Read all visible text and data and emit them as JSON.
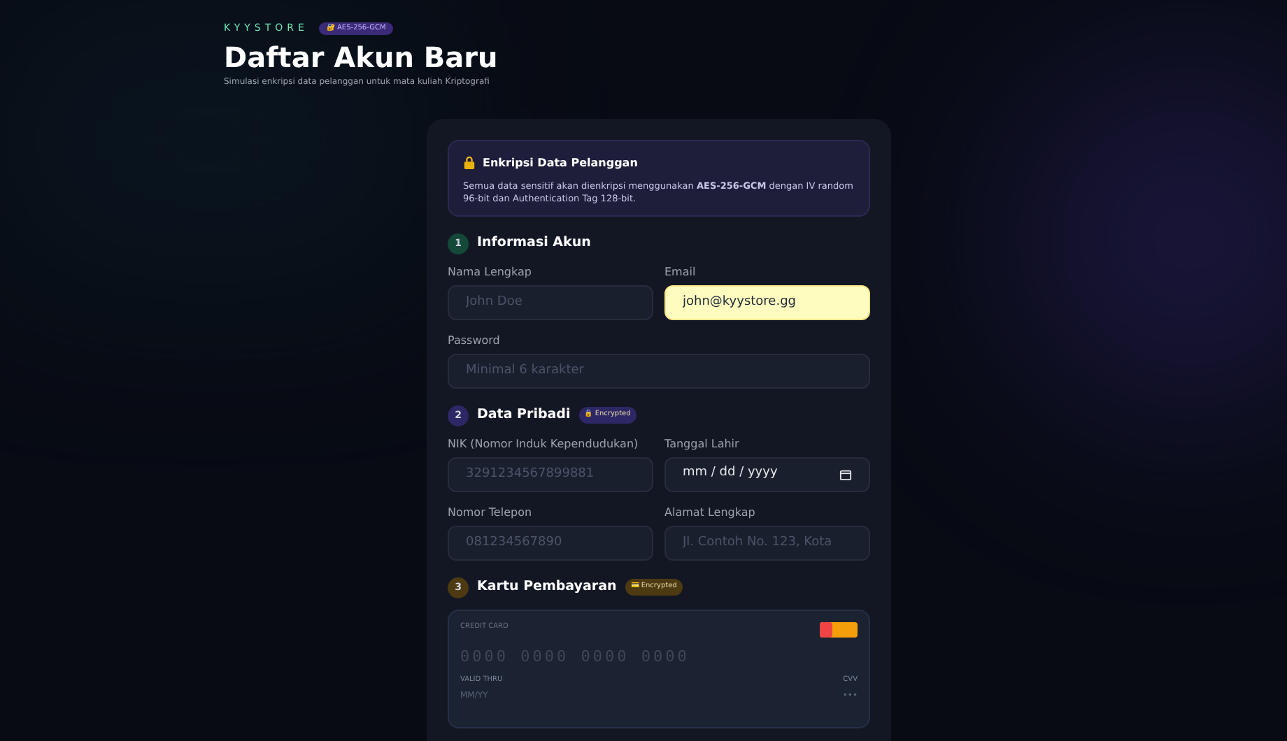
{
  "header": {
    "brand": "KYYSTORE",
    "badge": "🔐 AES-256-GCM",
    "title": "Daftar Akun Baru",
    "subtitle": "Simulasi enkripsi data pelanggan untuk mata kuliah Kriptografi"
  },
  "notice": {
    "title": "Enkripsi Data Pelanggan",
    "text": "Semua data sensitif akan dienkripsi menggunakan **AES-256-GCM** dengan IV random 96-bit dan Authentication Tag 128-bit."
  },
  "sections": [
    {
      "number": "1",
      "title": "Informasi Akun",
      "color": "#14493a",
      "fields": [
        {
          "label": "Nama Lengkap",
          "placeholder": "John Doe",
          "kind": "text",
          "highlighted": false
        },
        {
          "label": "Email",
          "value": "john@kyystore.gg",
          "kind": "text",
          "highlighted": true
        },
        {
          "label": "Password",
          "placeholder": "Minimal 6 karakter",
          "kind": "wide",
          "highlighted": false
        }
      ]
    },
    {
      "number": "2",
      "title": "Data Pribadi",
      "color": "#2e2766",
      "badge": "🔒 Encrypted",
      "fields": [
        {
          "label": "NIK (Nomor Induk Kependudukan)",
          "placeholder": "3291234567899881",
          "kind": "text",
          "highlighted": false
        },
        {
          "label": "Tanggal Lahir",
          "value": "mm / dd / yyyy",
          "kind": "date",
          "highlighted": false
        },
        {
          "label": "Nomor Telepon",
          "placeholder": "081234567890",
          "kind": "text",
          "highlighted": false
        },
        {
          "label": "Alamat Lengkap",
          "placeholder": "Jl. Contoh No. 123, Kota",
          "kind": "text",
          "highlighted": false
        }
      ]
    },
    {
      "number": "3",
      "title": "Kartu Pembayaran",
      "color": "#4d3a12",
      "badge": "💳 Encrypted"
    }
  ],
  "card": {
    "label": "CREDIT CARD",
    "number_placeholder": "0000 0000 0000 0000",
    "valid_label": "VALID THRU",
    "valid_placeholder": "MM/YY",
    "cvv_label": "CVV",
    "cvv_placeholder": "•••"
  }
}
